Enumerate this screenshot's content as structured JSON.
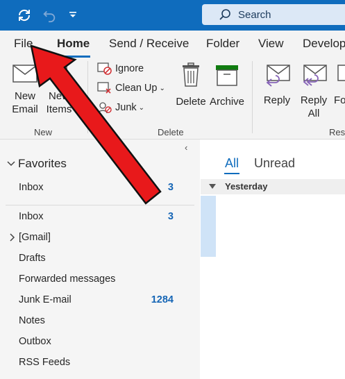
{
  "search": {
    "label": "Search"
  },
  "tabs": [
    "File",
    "Home",
    "Send / Receive",
    "Folder",
    "View",
    "Develop"
  ],
  "ribbon": {
    "new_email": [
      "New",
      "Email"
    ],
    "new_items": [
      "New",
      "Items"
    ],
    "ignore": "Ignore",
    "clean_up": "Clean Up",
    "junk": "Junk",
    "delete": "Delete",
    "archive": "Archive",
    "reply": "Reply",
    "reply_all": [
      "Reply",
      "All"
    ],
    "forward_partial": "Fo",
    "groups": {
      "new": "New",
      "delete": "Delete",
      "respond_partial": "Resp"
    }
  },
  "favorites": {
    "header": "Favorites",
    "items": [
      {
        "label": "Inbox",
        "count": "3"
      }
    ]
  },
  "folders": [
    {
      "label": "Inbox",
      "count": "3"
    },
    {
      "label": "[Gmail]",
      "count": ""
    },
    {
      "label": "Drafts",
      "count": ""
    },
    {
      "label": "Forwarded messages",
      "count": ""
    },
    {
      "label": "Junk E-mail",
      "count": "1284"
    },
    {
      "label": "Notes",
      "count": ""
    },
    {
      "label": "Outbox",
      "count": ""
    },
    {
      "label": "RSS Feeds",
      "count": ""
    }
  ],
  "message_list": {
    "tabs": [
      "All",
      "Unread"
    ],
    "group_header": "Yesterday"
  },
  "colors": {
    "brand": "#0f6cbd",
    "annotation_arrow": "#e8191b",
    "count_text": "#1565b5"
  }
}
